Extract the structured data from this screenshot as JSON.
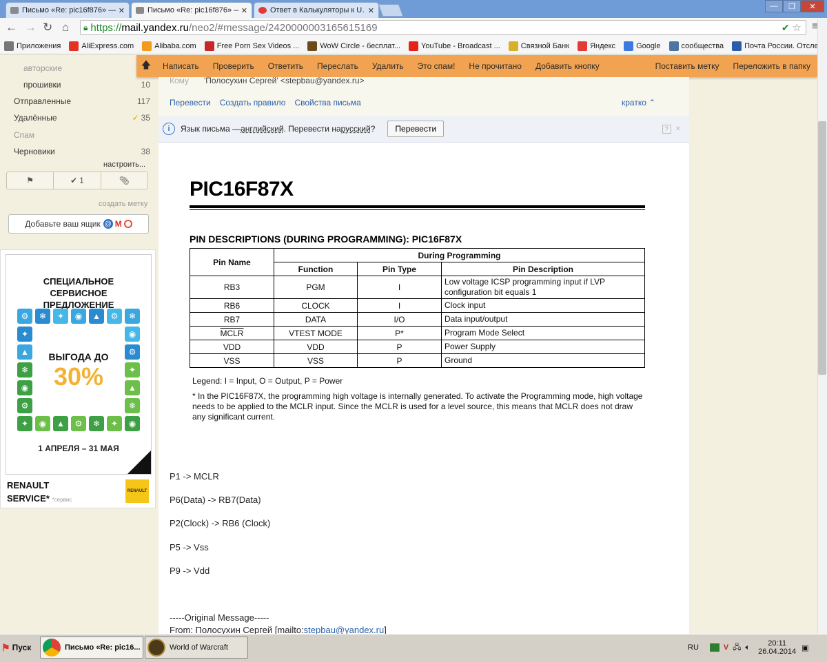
{
  "tabs": [
    {
      "title": "Письмо «Re: pic16f876» — …",
      "active": false
    },
    {
      "title": "Письмо «Re: pic16f876» — …",
      "active": true
    },
    {
      "title": "Ответ в Калькуляторы к U…",
      "active": false
    }
  ],
  "address": {
    "scheme": "https://",
    "host": "mail.yandex.ru",
    "path": "/neo2/#message/2420000003165615169"
  },
  "bookmarks": [
    {
      "label": "Приложения",
      "icon": "apps-icon",
      "color": "#777777"
    },
    {
      "label": "AliExpress.com",
      "icon": "aliexpress-icon",
      "color": "#e43225"
    },
    {
      "label": "Alibaba.com",
      "icon": "alibaba-icon",
      "color": "#f39a1c"
    },
    {
      "label": "Free Porn Sex Videos ...",
      "icon": "bookmark-r-icon",
      "color": "#c62828"
    },
    {
      "label": "WoW Circle - бесплат...",
      "icon": "wow-icon",
      "color": "#6d4c1a"
    },
    {
      "label": "YouTube - Broadcast ...",
      "icon": "youtube-icon",
      "color": "#e62117"
    },
    {
      "label": "Связной Банк",
      "icon": "svyaznoy-icon",
      "color": "#d8b12a"
    },
    {
      "label": "Яндекс",
      "icon": "yandex-icon",
      "color": "#e53935"
    },
    {
      "label": "Google",
      "icon": "google-icon",
      "color": "#3d7ae0"
    },
    {
      "label": "сообщества",
      "icon": "vk-icon",
      "color": "#4c75a3"
    },
    {
      "label": "Почта России. Отсле...",
      "icon": "russian-post-icon",
      "color": "#2a5caa"
    }
  ],
  "actionbar": {
    "actions": [
      "Написать",
      "Проверить",
      "Ответить",
      "Переслать",
      "Удалить",
      "Это спам!",
      "Не прочитано",
      "Добавить кнопку"
    ],
    "right": [
      "Поставить метку",
      "Переложить в папку"
    ]
  },
  "sidebar": {
    "folders": [
      {
        "name": "авторские",
        "count": ""
      },
      {
        "name": "прошивки",
        "count": "10"
      },
      {
        "name": "Отправленные",
        "count": "117"
      },
      {
        "name": "Удалённые",
        "count": "35"
      },
      {
        "name": "Спам",
        "count": ""
      },
      {
        "name": "Черновики",
        "count": "38"
      }
    ],
    "configure": "настроить...",
    "flag_count": "1",
    "create_label": "создать метку",
    "add_box": "Добавьте ваш ящик"
  },
  "ad": {
    "title": "СПЕЦИАЛЬНОЕ СЕРВИСНОЕ ПРЕДЛОЖЕНИЕ",
    "benefit": "ВЫГОДА ДО",
    "percent": "30%",
    "dates": "1 АПРЕЛЯ – 31 МАЯ",
    "brand1": "RENAULT",
    "brand2": "SERVICE*",
    "brand_note": "*сервис",
    "logo": "RENAULT"
  },
  "message": {
    "to_label": "Кому",
    "to_value": "'Полосухин Сергей' <stepbau@yandex.ru>",
    "links": [
      "Перевести",
      "Создать правило",
      "Свойства письма"
    ],
    "brief": "кратко",
    "translate_text_1": "Язык письма — ",
    "translate_lang_from": "английский",
    "translate_text_2": ". Перевести на ",
    "translate_lang_to": "русский",
    "translate_text_3": "?",
    "translate_button": "Перевести",
    "doc_title": "PIC16F87X",
    "table_title": "PIN DESCRIPTIONS (DURING PROGRAMMING): PIC16F87X",
    "table_headers": {
      "pin_name": "Pin Name",
      "during": "During Programming",
      "function": "Function",
      "pin_type": "Pin Type",
      "pin_desc": "Pin Description"
    },
    "rows": [
      {
        "pin": "RB3",
        "func": "PGM",
        "type": "I",
        "desc": "Low voltage ICSP programming input if LVP configuration bit equals 1"
      },
      {
        "pin": "RB6",
        "func": "CLOCK",
        "type": "I",
        "desc": "Clock input"
      },
      {
        "pin": "RB7",
        "func": "DATA",
        "type": "I/O",
        "desc": "Data input/output"
      },
      {
        "pin": "MCLR",
        "func": "VTEST MODE",
        "type": "P*",
        "desc": "Program Mode Select"
      },
      {
        "pin": "VDD",
        "func": "VDD",
        "type": "P",
        "desc": "Power Supply"
      },
      {
        "pin": "VSS",
        "func": "VSS",
        "type": "P",
        "desc": "Ground"
      }
    ],
    "legend": "Legend:  I = Input, O = Output, P = Power",
    "footnote": "* In the PIC16F87X, the programming high voltage is internally generated. To activate the Programming mode, high voltage needs to be applied to the MCLR input. Since the MCLR is used for a level source, this means that MCLR does not draw any significant current.",
    "lines": [
      "P1 -> MCLR",
      "P6(Data)  -> RB7(Data)",
      "P2(Clock) -> RB6 (Clock)",
      "P5 -> Vss",
      "P9 -> Vdd"
    ],
    "original": "-----Original Message-----",
    "from_prefix": "From: Полосухин Сергей [mailto:",
    "from_email": "stepbau@yandex.ru",
    "from_suffix": "]"
  },
  "taskbar": {
    "start": "Пуск",
    "items": [
      "Письмо «Re: pic16...",
      "World of Warcraft"
    ],
    "lang": "RU",
    "time": "20:11",
    "date": "26.04.2014"
  },
  "colors": {
    "action_bar": "#f2a352",
    "sidebar_bg": "#f3f0df",
    "link": "#2b5fab"
  }
}
